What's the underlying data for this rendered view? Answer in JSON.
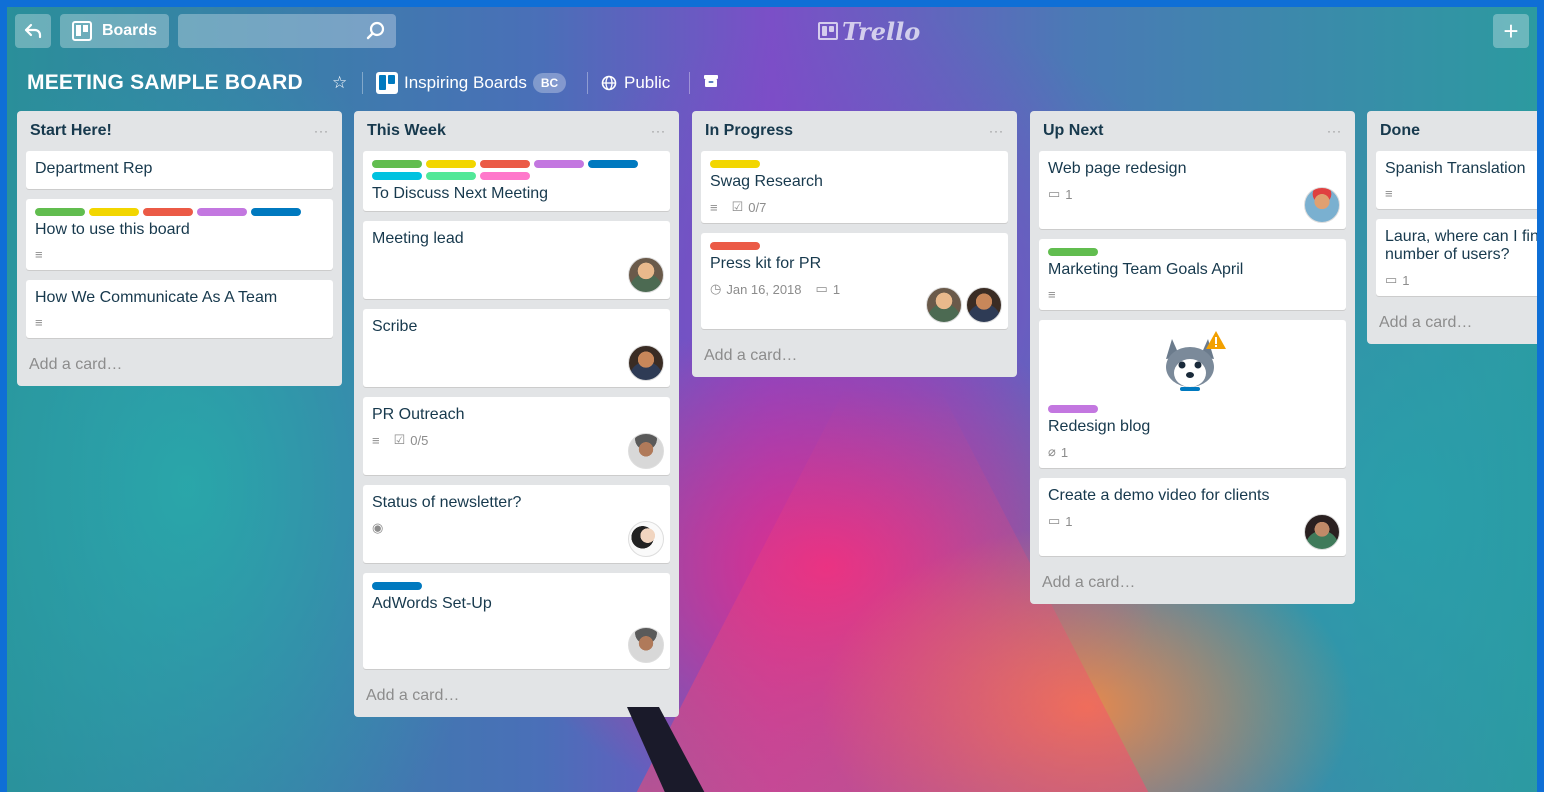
{
  "header": {
    "boards_label": "Boards",
    "logo_text": "Trello",
    "add_label": "+"
  },
  "board": {
    "title": "MEETING SAMPLE BOARD",
    "team": "Inspiring Boards",
    "team_badge": "BC",
    "visibility": "Public"
  },
  "colors": {
    "green": "#61bd4f",
    "yellow": "#f2d600",
    "red": "#eb5a46",
    "purple": "#c377e0",
    "blue": "#0079bf",
    "sky": "#00c2e0",
    "lime": "#51e898",
    "pink": "#ff78cb"
  },
  "lists": [
    {
      "title": "Start Here!",
      "menu": "···",
      "cards": [
        {
          "title": "Department Rep"
        },
        {
          "title": "How to use this board",
          "labels": [
            "green",
            "yellow",
            "red",
            "purple",
            "blue"
          ],
          "description": true
        },
        {
          "title": "How We Communicate As A Team",
          "description": true
        }
      ],
      "add_card": "Add a card…"
    },
    {
      "title": "This Week",
      "menu": "···",
      "cards": [
        {
          "title": "To Discuss Next Meeting",
          "labels": [
            "green",
            "yellow",
            "red",
            "purple",
            "blue",
            "sky",
            "lime",
            "pink"
          ]
        },
        {
          "title": "Meeting lead",
          "members": [
            "avatar-1"
          ]
        },
        {
          "title": "Scribe",
          "members": [
            "avatar-2"
          ]
        },
        {
          "title": "PR Outreach",
          "description": true,
          "checklist": "0/5",
          "members": [
            "avatar-3"
          ]
        },
        {
          "title": "Status of newsletter?",
          "watching": true,
          "members": [
            "avatar-4"
          ]
        },
        {
          "title": "AdWords Set-Up",
          "labels": [
            "blue"
          ],
          "members": [
            "avatar-3"
          ]
        }
      ],
      "add_card": "Add a card…"
    },
    {
      "title": "In Progress",
      "menu": "···",
      "cards": [
        {
          "title": "Swag Research",
          "labels": [
            "yellow"
          ],
          "description": true,
          "checklist": "0/7"
        },
        {
          "title": "Press kit for PR",
          "labels": [
            "red"
          ],
          "due": "Jan 16, 2018",
          "comments": "1",
          "members": [
            "avatar-1",
            "avatar-2"
          ]
        }
      ],
      "add_card": "Add a card…"
    },
    {
      "title": "Up Next",
      "menu": "···",
      "cards": [
        {
          "title": "Web page redesign",
          "comments": "1",
          "members": [
            "avatar-5"
          ]
        },
        {
          "title": "Marketing Team Goals April",
          "labels": [
            "green"
          ],
          "description": true
        },
        {
          "title": "Redesign blog",
          "labels": [
            "purple"
          ],
          "attachments": "1",
          "cover": "husky-icon"
        },
        {
          "title": "Create a demo video for clients",
          "comments": "1",
          "members": [
            "avatar-6"
          ]
        }
      ],
      "add_card": "Add a card…"
    },
    {
      "title": "Done",
      "menu": "",
      "cards": [
        {
          "title": "Spanish Translation",
          "description": true
        },
        {
          "title": "Laura, where can I find number of users?",
          "comments": "1"
        }
      ],
      "add_card": "Add a card…"
    }
  ]
}
